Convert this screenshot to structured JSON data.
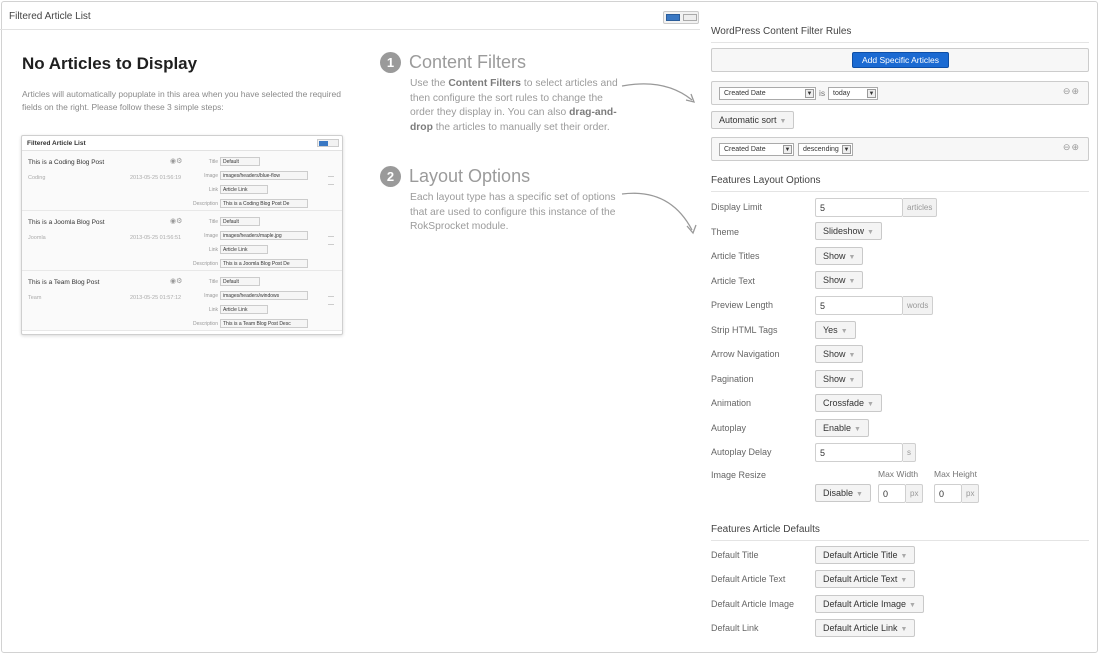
{
  "left": {
    "header_title": "Filtered Article List",
    "empty_title": "No Articles to Display",
    "empty_desc": "Articles will automatically popuplate in this area when you have selected the required fields on the right. Please follow these 3 simple steps:",
    "preview": {
      "title": "Filtered Article List",
      "rows": [
        {
          "title": "This is a Coding Blog Post",
          "category": "Coding",
          "date": "2013-05-25 01:56:19",
          "title_val": "Default",
          "image_val": "images/headers/blue-flow",
          "link_val": "Article Link",
          "desc_val": "This is a Coding Blog Post De"
        },
        {
          "title": "This is a Joomla Blog Post",
          "category": "Joomla",
          "date": "2013-05-25 01:56:51",
          "title_val": "Default",
          "image_val": "images/headers/maple.jpg",
          "link_val": "Article Link",
          "desc_val": "This is a Joomla Blog Post De"
        },
        {
          "title": "This is a Team Blog Post",
          "category": "Team",
          "date": "2013-05-25 01:57:12",
          "title_val": "Default",
          "image_val": "images/headers/windows",
          "link_val": "Article Link",
          "desc_val": "This is a Team Blog Post Desc"
        }
      ],
      "field_labels": {
        "title": "Title",
        "image": "Image",
        "link": "Link",
        "description": "Description"
      }
    }
  },
  "steps": [
    {
      "num": "1",
      "title": "Content Filters",
      "p1": "Use the ",
      "b1": "Content Filters",
      "p2": " to select articles and then configure the sort rules to change the order they display in. You can also ",
      "b2": "drag-and-drop",
      "p3": " the articles to manually set their order."
    },
    {
      "num": "2",
      "title": "Layout Options",
      "text": "Each layout type has a specific set of options that are used to configure this instance of the RokSprocket module."
    }
  ],
  "filters": {
    "section_title": "WordPress Content Filter Rules",
    "add_button": "Add Specific Articles",
    "rule": {
      "field": "Created Date",
      "op": "is",
      "value": "today"
    },
    "sort_button": "Automatic sort",
    "sort": {
      "field": "Created Date",
      "direction": "descending"
    }
  },
  "layout": {
    "section_title": "Features Layout Options",
    "display_limit": {
      "label": "Display Limit",
      "value": "5",
      "suffix": "articles"
    },
    "theme": {
      "label": "Theme",
      "value": "Slideshow"
    },
    "article_titles": {
      "label": "Article Titles",
      "value": "Show"
    },
    "article_text": {
      "label": "Article Text",
      "value": "Show"
    },
    "preview_length": {
      "label": "Preview Length",
      "value": "5",
      "suffix": "words"
    },
    "strip_html": {
      "label": "Strip HTML Tags",
      "value": "Yes"
    },
    "arrow_nav": {
      "label": "Arrow Navigation",
      "value": "Show"
    },
    "pagination": {
      "label": "Pagination",
      "value": "Show"
    },
    "animation": {
      "label": "Animation",
      "value": "Crossfade"
    },
    "autoplay": {
      "label": "Autoplay",
      "value": "Enable"
    },
    "autoplay_delay": {
      "label": "Autoplay Delay",
      "value": "5",
      "suffix": "s"
    },
    "image_resize": {
      "label": "Image Resize",
      "value": "Disable",
      "max_width_label": "Max Width",
      "max_width": "0",
      "max_height_label": "Max Height",
      "max_height": "0",
      "unit": "px"
    }
  },
  "defaults": {
    "section_title": "Features Article Defaults",
    "title": {
      "label": "Default Title",
      "value": "Default Article Title"
    },
    "text": {
      "label": "Default Article Text",
      "value": "Default Article Text"
    },
    "image": {
      "label": "Default Article Image",
      "value": "Default Article Image"
    },
    "link": {
      "label": "Default Link",
      "value": "Default Article Link"
    }
  },
  "icons": {
    "dropdown": "caret-down-icon",
    "remove": "minus-circle-icon",
    "add": "plus-circle-icon",
    "eye": "eye-icon",
    "gear": "gear-icon"
  }
}
